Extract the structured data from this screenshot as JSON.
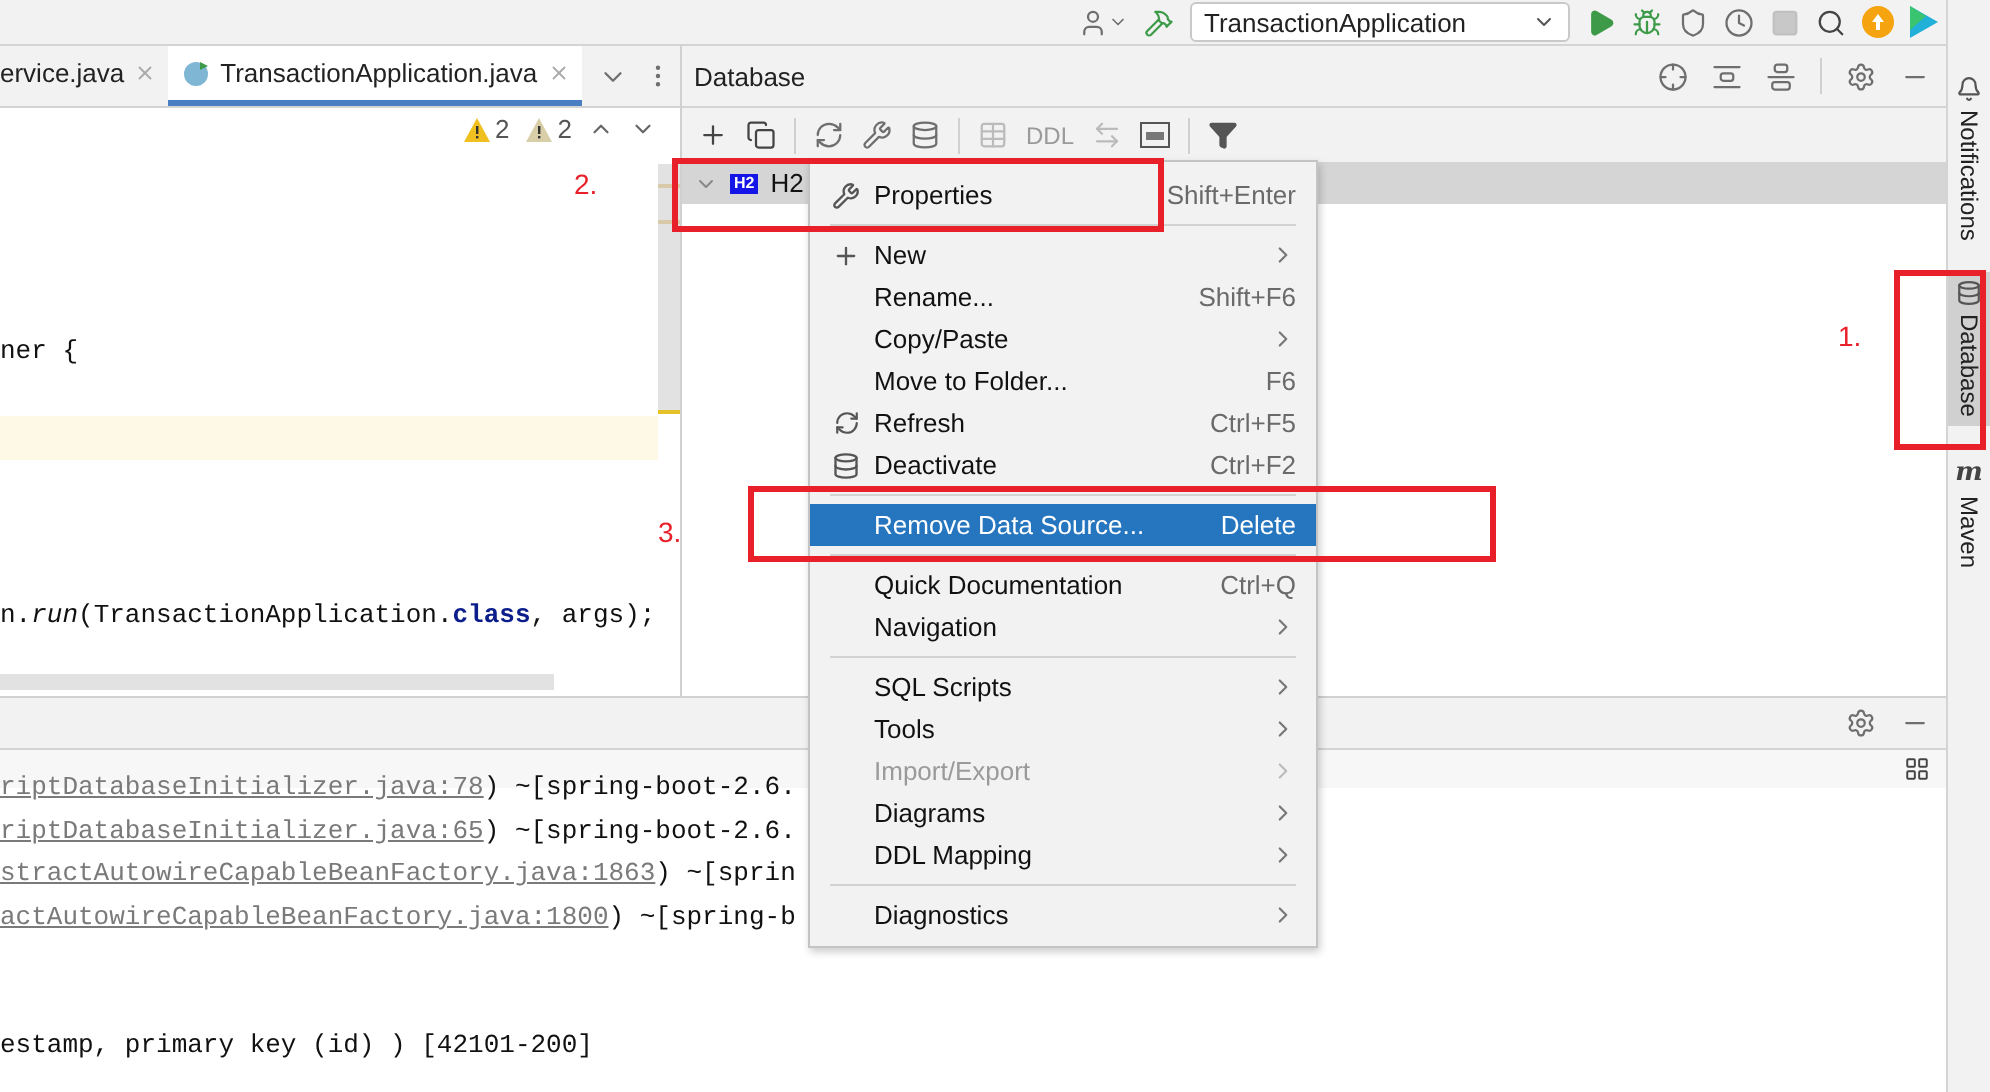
{
  "toolbar": {
    "run_config": "TransactionApplication"
  },
  "editor": {
    "tabs": [
      {
        "label": "ervice.java",
        "selected": false
      },
      {
        "label": "TransactionApplication.java",
        "selected": true
      }
    ],
    "warnings": [
      {
        "kind": "warning",
        "count": "2"
      },
      {
        "kind": "weak",
        "count": "2"
      }
    ],
    "lines": [
      {
        "kind": "blank"
      },
      {
        "kind": "blank"
      },
      {
        "kind": "blank"
      },
      {
        "kind": "blank"
      },
      {
        "kind": "blank"
      },
      {
        "kind": "code",
        "text": "ner {"
      },
      {
        "kind": "blank"
      },
      {
        "kind": "current"
      },
      {
        "kind": "blank"
      },
      {
        "kind": "blank"
      },
      {
        "kind": "blank"
      },
      {
        "kind": "code",
        "text": "n.*run*(TransactionApplication.**class**, args);"
      }
    ]
  },
  "database": {
    "title": "Database",
    "ddl_label": "DDL",
    "tree": [
      {
        "label": "H2",
        "badge": "H2",
        "selected": true,
        "expanded": true
      }
    ]
  },
  "context_menu": [
    {
      "kind": "item",
      "label": "Properties",
      "shortcut": "Shift+Enter",
      "submenu": false,
      "disabled": false,
      "selected": false
    },
    {
      "kind": "separator"
    },
    {
      "kind": "item",
      "label": "New",
      "submenu": true,
      "disabled": false,
      "selected": false
    },
    {
      "kind": "item",
      "label": "Rename...",
      "shortcut": "Shift+F6",
      "submenu": false,
      "disabled": false,
      "selected": false
    },
    {
      "kind": "item",
      "label": "Copy/Paste",
      "submenu": true,
      "disabled": false,
      "selected": false
    },
    {
      "kind": "item",
      "label": "Move to Folder...",
      "shortcut": "F6",
      "submenu": false,
      "disabled": false,
      "selected": false
    },
    {
      "kind": "item",
      "label": "Refresh",
      "shortcut": "Ctrl+F5",
      "submenu": false,
      "disabled": false,
      "selected": false
    },
    {
      "kind": "item",
      "label": "Deactivate",
      "shortcut": "Ctrl+F2",
      "submenu": false,
      "disabled": false,
      "selected": false
    },
    {
      "kind": "separator"
    },
    {
      "kind": "item",
      "label": "Remove Data Source...",
      "shortcut": "Delete",
      "submenu": false,
      "disabled": false,
      "selected": true
    },
    {
      "kind": "separator"
    },
    {
      "kind": "item",
      "label": "Quick Documentation",
      "shortcut": "Ctrl+Q",
      "submenu": false,
      "disabled": false,
      "selected": false
    },
    {
      "kind": "item",
      "label": "Navigation",
      "submenu": true,
      "disabled": false,
      "selected": false
    },
    {
      "kind": "separator"
    },
    {
      "kind": "item",
      "label": "SQL Scripts",
      "submenu": true,
      "disabled": false,
      "selected": false
    },
    {
      "kind": "item",
      "label": "Tools",
      "submenu": true,
      "disabled": false,
      "selected": false
    },
    {
      "kind": "item",
      "label": "Import/Export",
      "submenu": true,
      "disabled": true,
      "selected": false
    },
    {
      "kind": "item",
      "label": "Diagrams",
      "submenu": true,
      "disabled": false,
      "selected": false
    },
    {
      "kind": "item",
      "label": "DDL Mapping",
      "submenu": true,
      "disabled": false,
      "selected": false
    },
    {
      "kind": "separator"
    },
    {
      "kind": "item",
      "label": "Diagnostics",
      "submenu": true,
      "disabled": false,
      "selected": false
    }
  ],
  "console": [
    {
      "kind": "line",
      "link": "riptDatabaseInitializer.java:78",
      "text": ") ~[spring-boot-2.6."
    },
    {
      "kind": "line",
      "link": "riptDatabaseInitializer.java:65",
      "text": ") ~[spring-boot-2.6."
    },
    {
      "kind": "line",
      "link": "stractAutowireCapableBeanFactory.java:1863",
      "text": ") ~[sprin"
    },
    {
      "kind": "line",
      "link": "actAutowireCapableBeanFactory.java:1800",
      "text": ") ~[spring-b"
    },
    {
      "kind": "blank"
    },
    {
      "kind": "blank"
    },
    {
      "kind": "line",
      "text": "estamp, primary key (id) ) [42101-200]"
    }
  ],
  "tool_windows": [
    {
      "label": "Notifications",
      "selected": false
    },
    {
      "label": "Database",
      "selected": true
    },
    {
      "label": "Maven",
      "icon_text": "m",
      "selected": false
    }
  ],
  "annotations": [
    {
      "label": "1."
    },
    {
      "label": "2."
    },
    {
      "label": "3."
    }
  ]
}
